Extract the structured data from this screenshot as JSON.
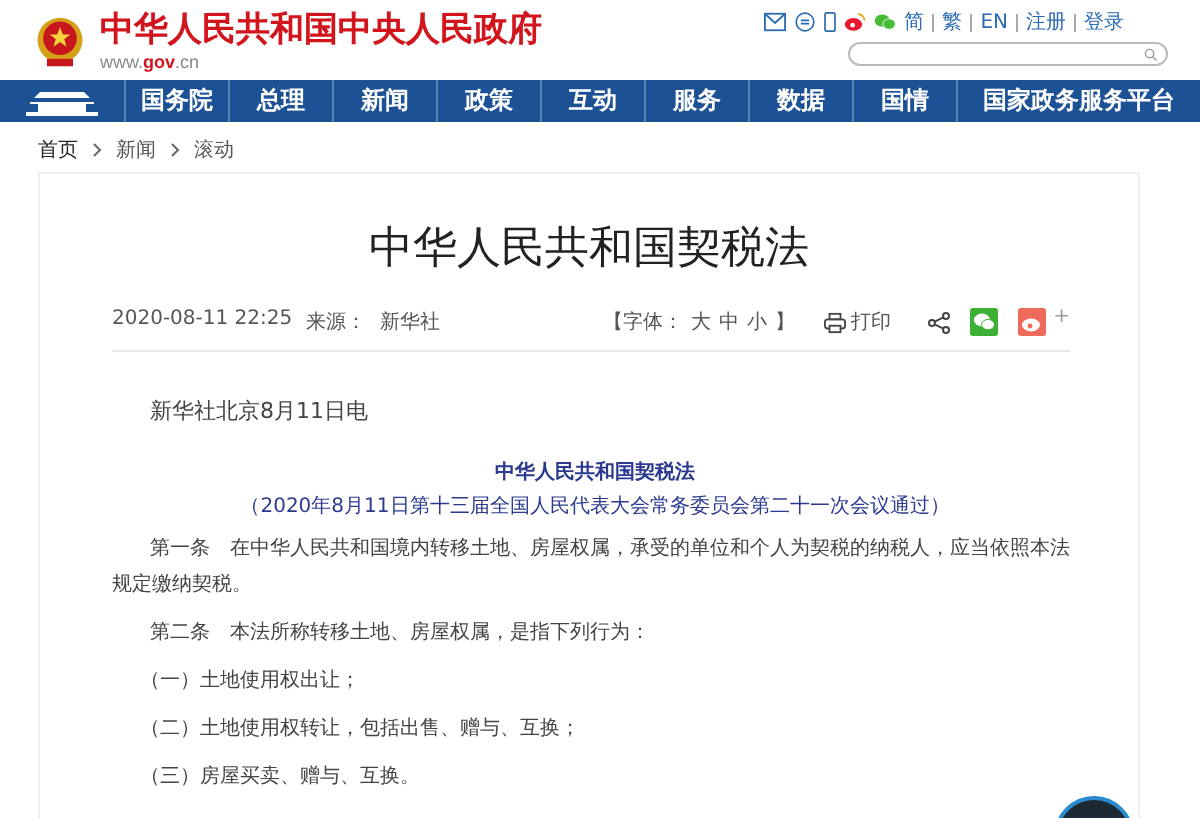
{
  "header": {
    "site_title": "中华人民共和国中央人民政府",
    "site_url": "www.**gov**.cn",
    "links": [
      "简",
      "繁",
      "EN",
      "注册",
      "登录"
    ]
  },
  "nav": {
    "items": [
      {
        "label": "国务院",
        "selected": false
      },
      {
        "label": "总理",
        "selected": false
      },
      {
        "label": "新闻",
        "selected": false
      },
      {
        "label": "政策",
        "selected": false
      },
      {
        "label": "互动",
        "selected": false
      },
      {
        "label": "服务",
        "selected": false
      },
      {
        "label": "数据",
        "selected": false
      },
      {
        "label": "国情",
        "selected": false
      },
      {
        "label": "国家政务服务平台",
        "selected": false
      }
    ]
  },
  "breadcrumb": [
    "首页",
    "新闻",
    "滚动"
  ],
  "article": {
    "title": "中华人民共和国契税法",
    "date": "2020-08-11 22:25",
    "source_label": "来源：",
    "source": "新华社",
    "font_label": "【字体：",
    "font_sizes": [
      "大",
      "中",
      "小"
    ],
    "font_close": "】",
    "print": "打印",
    "more": "+",
    "dateline": "新华社北京8月11日电",
    "law_title": "中华人民共和国契税法",
    "law_subtitle": "（2020年8月11日第十三届全国人民代表大会常务委员会第二十一次会议通过）",
    "paragraphs": [
      {
        "kind": "article",
        "text": "第一条　在中华人民共和国境内转移土地、房屋权属，承受的单位和个人为契税的纳税人，应当依照本法规定缴纳契税。"
      },
      {
        "kind": "article",
        "text": "第二条　本法所称转移土地、房屋权属，是指下列行为："
      },
      {
        "kind": "item",
        "text": "（一）土地使用权出让；"
      },
      {
        "kind": "item",
        "text": "（二）土地使用权转让，包括出售、赠与、互换；"
      },
      {
        "kind": "item",
        "text": "（三）房屋买卖、赠与、互换。"
      }
    ]
  }
}
